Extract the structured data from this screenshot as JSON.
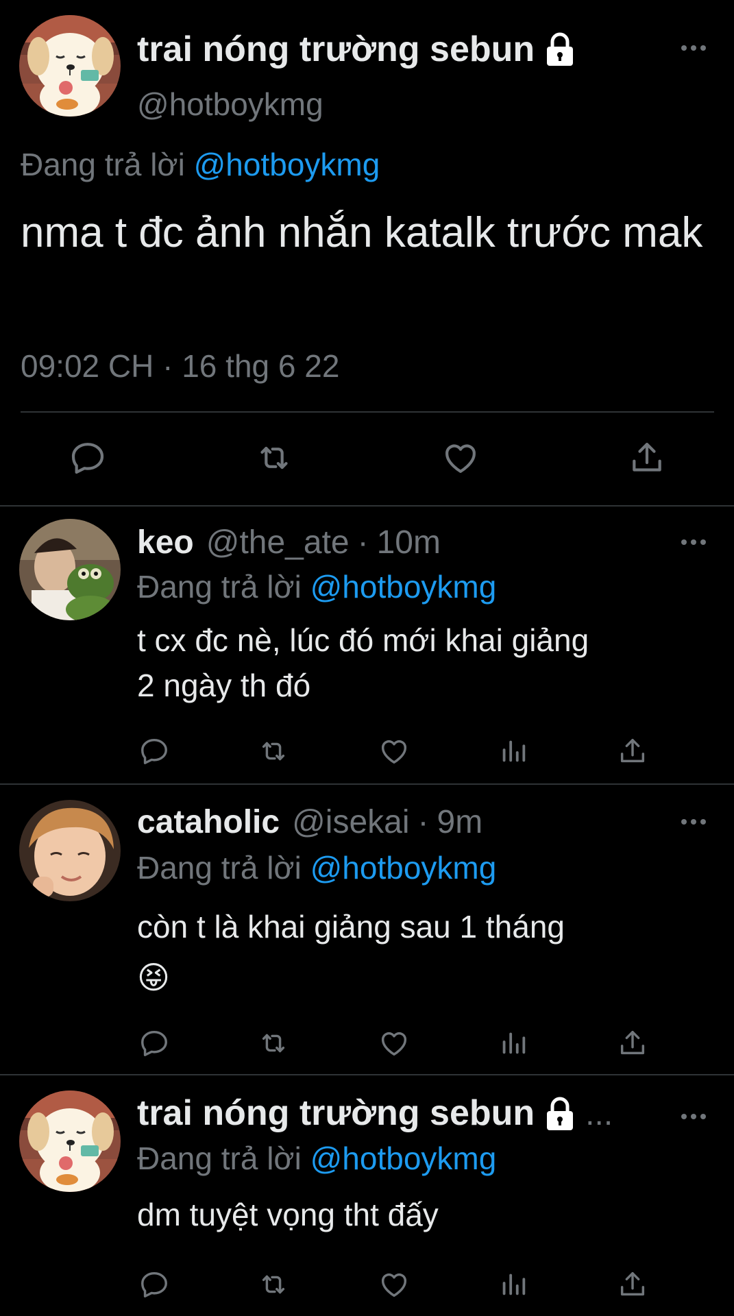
{
  "main_tweet": {
    "name": "trai nóng trường sebun",
    "handle": "@hotboykmg",
    "replying_prefix": "Đang trả lời",
    "replying_to": "@hotboykmg",
    "text": "nma t đc ảnh nhắn katalk trước mak",
    "timestamp": "09:02 CH · 16 thg 6 22",
    "icons": [
      "reply-icon",
      "retweet-icon",
      "like-icon",
      "share-icon"
    ]
  },
  "replies": [
    {
      "name": "keo",
      "handle": "@the_ate",
      "separator": "·",
      "time": "10m",
      "replying_prefix": "Đang trả lời",
      "replying_to": "@hotboykmg",
      "text_line1": "t cx đc nè, lúc đó mới khai giảng",
      "text_line2": "2 ngày th đó"
    },
    {
      "name": "cataholic",
      "handle": "@isekai",
      "separator": "·",
      "time": "9m",
      "replying_prefix": "Đang trả lời",
      "replying_to": "@hotboykmg",
      "text_line1": "còn t là khai giảng sau 1 tháng",
      "text_line2": "😝"
    },
    {
      "name": "trai nóng trường sebun",
      "trail": "...",
      "replying_prefix": "Đang trả lời",
      "replying_to": "@hotboykmg",
      "text_line1": "dm tuyệt vọng tht đấy"
    }
  ],
  "colors": {
    "background": "#000000",
    "text": "#e7e9ea",
    "muted": "#71767b",
    "link": "#1d9bf0",
    "divider": "#2f3336"
  }
}
